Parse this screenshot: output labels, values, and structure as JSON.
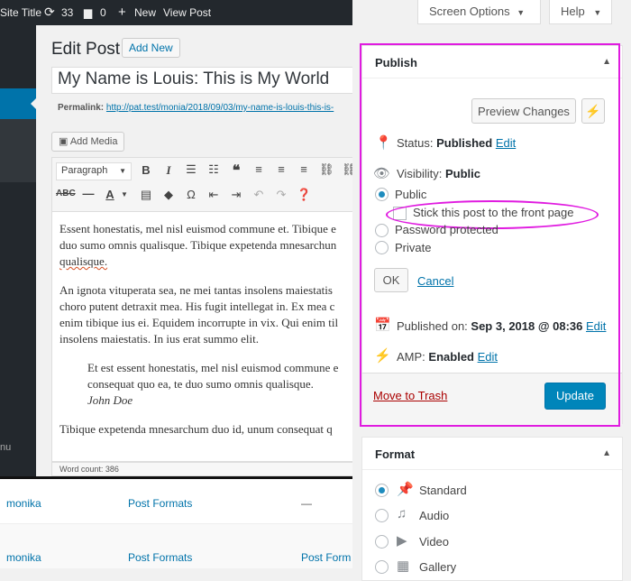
{
  "adminbar": {
    "site_title": "Site Title",
    "updates_count": "33",
    "comments_count": "0",
    "new_label": "New",
    "view_post": "View Post"
  },
  "sidebar": {
    "menu_text": "nu"
  },
  "editor": {
    "heading": "Edit Post",
    "add_new": "Add New",
    "title_value": "My Name is Louis: This is My World",
    "permalink_label": "Permalink:",
    "permalink_url": "http://pat.test/monia/2018/09/03/my-name-is-louis-this-is-",
    "add_media": "Add Media",
    "format_select": "Paragraph",
    "paragraphs": [
      [
        "Essent honestatis, mel nisl euismod commune et. Tibique e",
        "duo sumo omnis qualisque. Tibique expetenda mnesarchun",
        "qualisque."
      ],
      [
        "An ignota vituperata sea, ne mei tantas insolens maiestatis",
        "choro putent detraxit mea. His fugit intellegat in. Ex mea c",
        "enim tibique ius ei. Equidem incorrupte in vix. Qui enim til",
        "insolens maiestatis. In ius erat summo elit."
      ],
      [
        "Et est essent honestatis, mel nisl euismod commune e",
        "consequat quo ea, te duo sumo omnis qualisque."
      ],
      [
        "Tibique expetenda mnesarchum duo id, unum consequat q"
      ]
    ],
    "quote_author": "John Doe",
    "word_count": "Word count: 386"
  },
  "list": {
    "rows": [
      {
        "author": "monika",
        "category": "Post Formats",
        "tags": "—"
      },
      {
        "author": "monika",
        "category": "Post Formats",
        "tags": "Post Form"
      }
    ]
  },
  "topbuttons": {
    "screen_options": "Screen Options",
    "help": "Help"
  },
  "publish": {
    "title": "Publish",
    "preview_changes": "Preview Changes",
    "status_label": "Status:",
    "status_value": "Published",
    "edit": "Edit",
    "visibility_label": "Visibility:",
    "visibility_value": "Public",
    "options": {
      "public": "Public",
      "stick": "Stick this post to the front page",
      "password": "Password protected",
      "private": "Private"
    },
    "ok": "OK",
    "cancel": "Cancel",
    "published_on_label": "Published on:",
    "published_on_value": "Sep 3, 2018 @ 08:36",
    "amp_label": "AMP:",
    "amp_value": "Enabled",
    "move_to_trash": "Move to Trash",
    "update": "Update"
  },
  "format": {
    "title": "Format",
    "options": [
      "Standard",
      "Audio",
      "Video",
      "Gallery"
    ]
  },
  "colors": {
    "accent": "#0073aa",
    "primary_button": "#0085ba",
    "highlight": "#e01be0"
  }
}
